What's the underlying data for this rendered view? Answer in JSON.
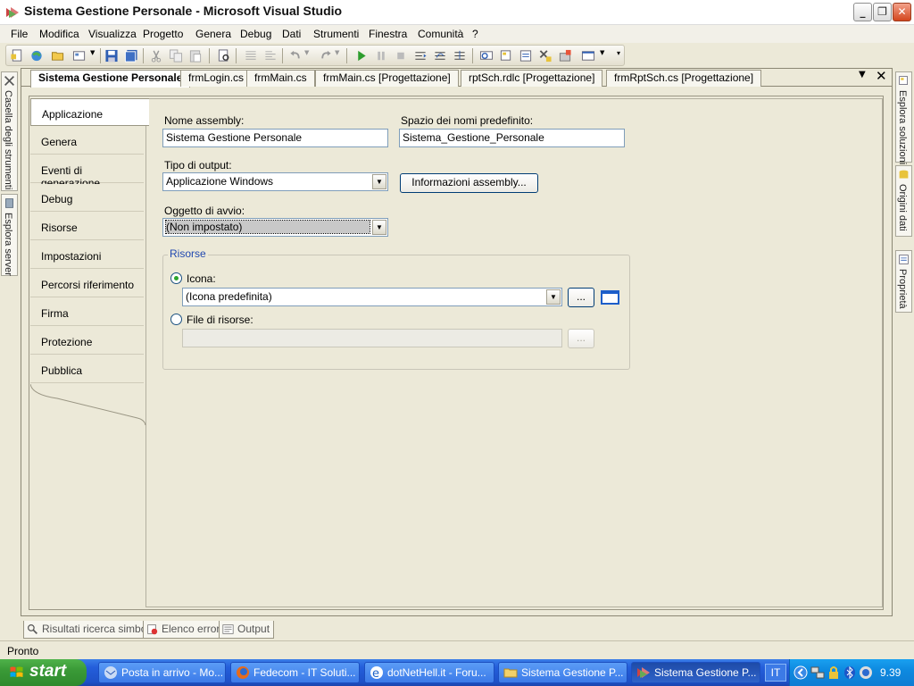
{
  "window": {
    "title": "Sistema Gestione Personale - Microsoft Visual Studio",
    "minimize": "_",
    "maximize": "❐",
    "close": "✕"
  },
  "menu": [
    "File",
    "Modifica",
    "Visualizza",
    "Progetto",
    "Genera",
    "Debug",
    "Dati",
    "Strumenti",
    "Finestra",
    "Comunità",
    "?"
  ],
  "left_strip": {
    "toolbox": "Casella degli strumenti",
    "server_explorer": "Esplora server"
  },
  "right_strip": {
    "solution_explorer": "Esplora soluzioni",
    "data_sources": "Origini dati",
    "properties": "Proprietà"
  },
  "doc_tabs": [
    "Sistema Gestione Personale",
    "frmLogin.cs",
    "frmMain.cs",
    "frmMain.cs [Progettazione]",
    "rptSch.rdlc [Progettazione]",
    "frmRptSch.cs [Progettazione]"
  ],
  "doc_tab_controls": {
    "dropdown": "▼",
    "close": "✕"
  },
  "nav": [
    "Applicazione",
    "Genera",
    "Eventi di generazione",
    "Debug",
    "Risorse",
    "Impostazioni",
    "Percorsi riferimento",
    "Firma",
    "Protezione",
    "Pubblica"
  ],
  "form": {
    "assembly_name_label": "Nome assembly:",
    "assembly_name_value": "Sistema Gestione Personale",
    "namespace_label": "Spazio dei nomi predefinito:",
    "namespace_value": "Sistema_Gestione_Personale",
    "output_type_label": "Tipo di output:",
    "output_type_value": "Applicazione Windows",
    "assembly_info_button": "Informazioni assembly...",
    "startup_object_label": "Oggetto di avvio:",
    "startup_object_value": "(Non impostato)",
    "resources": {
      "legend": "Risorse",
      "icon_label": "Icona:",
      "icon_value": "(Icona predefinita)",
      "browse": "...",
      "resource_file_label": "File di risorse:",
      "resource_file_value": "",
      "browse_disabled": "...",
      "selected_option": "Icona"
    }
  },
  "bottom_tabs": [
    "Risultati ricerca simbolo",
    "Elenco errori",
    "Output"
  ],
  "status": "Pronto",
  "taskbar": {
    "start": "start",
    "tasks": [
      "Posta in arrivo - Mo...",
      "Fedecom - IT Soluti...",
      "dotNetHell.it - Foru...",
      "Sistema Gestione P...",
      "Sistema Gestione P..."
    ],
    "language": "IT",
    "clock": "9.39"
  },
  "colors": {
    "accent": "#316ac5",
    "taskbar": "#245edb",
    "start_button": "#3a9a37",
    "tray": "#0e8ae0"
  }
}
